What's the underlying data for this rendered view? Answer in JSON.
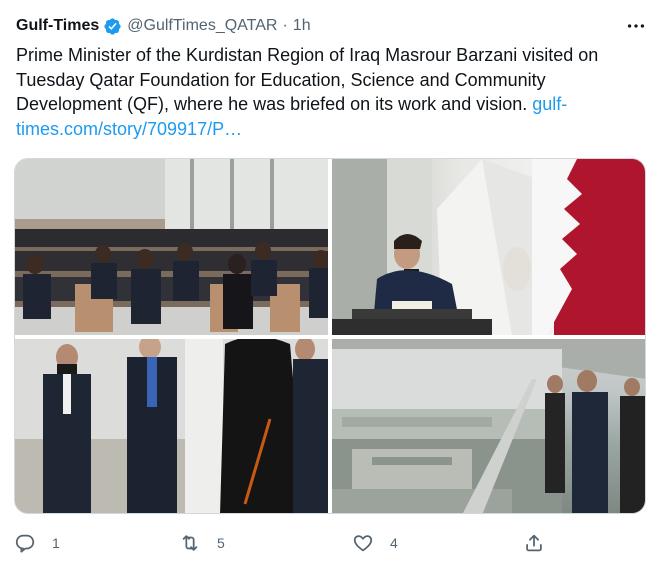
{
  "author": {
    "name": "Gulf-Times",
    "handle": "@GulfTimes_QATAR",
    "separator": "·",
    "time": "1h",
    "verified_icon": "verified-badge-icon"
  },
  "tweet": {
    "text": "Prime Minister of the Kurdistan Region of Iraq Masrour Barzani visited on Tuesday Qatar Foundation for Education, Science and Community Development (QF), where he was briefed on its work and vision.",
    "link_line1": "gulf-",
    "link_line2": "times.com/story/709917/P…"
  },
  "photos": [
    {
      "name": "conference-hall-photo"
    },
    {
      "name": "signing-guestbook-photo"
    },
    {
      "name": "walking-delegation-photo"
    },
    {
      "name": "balcony-view-photo"
    }
  ],
  "actions": {
    "reply_count": "1",
    "retweet_count": "5",
    "like_count": "4"
  },
  "colors": {
    "accent": "#1d9bf0",
    "text": "#0f1419",
    "secondary": "#536471"
  }
}
